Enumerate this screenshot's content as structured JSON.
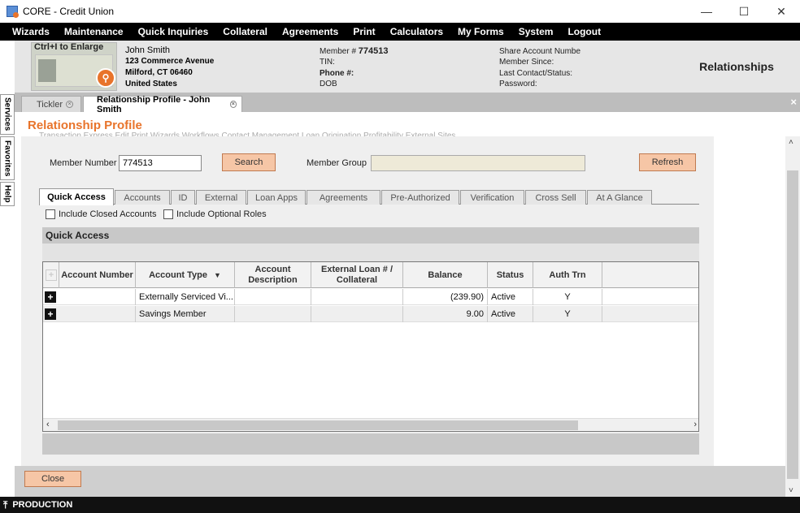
{
  "window": {
    "title": "CORE - Credit Union",
    "minimize": "—",
    "maximize": "☐",
    "close": "✕"
  },
  "menu": [
    "Wizards",
    "Maintenance",
    "Quick Inquiries",
    "Collateral",
    "Agreements",
    "Print",
    "Calculators",
    "My Forms",
    "System",
    "Logout"
  ],
  "member": {
    "enlarge_hint": "Ctrl+I to Enlarge",
    "name": "John Smith",
    "address1": "123 Commerce Avenue",
    "address2": "Milford, CT 06460",
    "country": "United States",
    "member_label": "Member #",
    "member_number": "774513",
    "tin_label": "TIN:",
    "phone_label": "Phone #:",
    "dob_label": "DOB",
    "share_account": "Share Account Numbe",
    "member_since": "Member Since:",
    "last_contact": "Last Contact/Status:",
    "password": "Password:"
  },
  "header_right": "Relationships",
  "side_tabs": [
    "Services",
    "Favorites",
    "Help"
  ],
  "doc_tabs": [
    {
      "label": "Tickler",
      "active": false
    },
    {
      "label": "Relationship Profile - John Smith",
      "active": true
    }
  ],
  "doc_close": "×",
  "page_title": "Relationship Profile",
  "hidden_toolbar": "Transaction Express   Edit   Print   Wizards   Workflows   Contact Management   Loan Origination   Profitability   External Sites",
  "form": {
    "member_number_label": "Member Number",
    "member_number_value": "774513",
    "search_label": "Search",
    "member_group_label": "Member Group",
    "refresh_label": "Refresh"
  },
  "sub_tabs": [
    "Quick Access",
    "Accounts",
    "ID",
    "External",
    "Loan Apps",
    "Agreements",
    "Pre-Authorized",
    "Verification",
    "Cross Sell",
    "At A Glance"
  ],
  "checkboxes": [
    "Include Closed Accounts",
    "Include Optional Roles"
  ],
  "quick_access_title": "Quick Access",
  "grid": {
    "plus_header": "+",
    "columns": [
      "Account Number",
      "Account Type",
      "Account Description",
      "External Loan # / Collateral",
      "Balance",
      "Status",
      "Auth Trn"
    ],
    "sort_icon": "chevron-down-icon",
    "rows": [
      {
        "expand": "+",
        "account_number": "",
        "account_type": "Externally Serviced Vi...",
        "description": "",
        "external_loan": "",
        "balance": "(239.90)",
        "status": "Active",
        "auth_trn": "Y"
      },
      {
        "expand": "+",
        "account_number": "",
        "account_type": "Savings Member",
        "description": "",
        "external_loan": "",
        "balance": "9.00",
        "status": "Active",
        "auth_trn": "Y"
      }
    ]
  },
  "close_label": "Close",
  "status": "PRODUCTION",
  "colors": {
    "accent": "#e8742b",
    "button": "#f6c6a6",
    "menubar": "#000000"
  }
}
